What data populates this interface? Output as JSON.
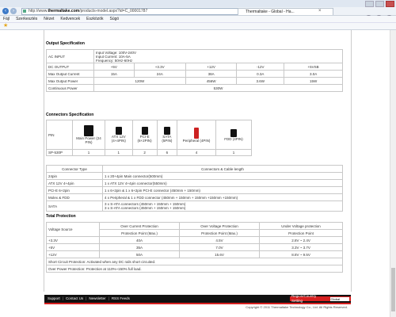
{
  "browser": {
    "url_prefix": "http://www.",
    "url_domain": "thermaltake.com",
    "url_suffix": "/products-model.aspx?id=C_00001787",
    "tab_title": "Thermaltake - Global - Ha...",
    "menu": [
      "Fájl",
      "Szerkesztés",
      "Nézet",
      "Kedvencek",
      "Eszközök",
      "Súgó"
    ]
  },
  "output_spec": {
    "title": "Output Specification",
    "ac_input_label": "AC INPUT",
    "ac_input_lines": [
      "Input Voltage: 100V-240V",
      "Input Current: 10A-5A",
      "Frequency: 50Hz-60Hz"
    ],
    "header": [
      "DC OUTPUT",
      "+5V",
      "+3.3V",
      "+12V",
      "-12V",
      "+5VSB"
    ],
    "rows": [
      [
        "Max Output Current",
        "15A",
        "24A",
        "38A",
        "0.3A",
        "3.0A"
      ],
      [
        "Max Output Power",
        "120W",
        "",
        "456W",
        "3.6W",
        "15W"
      ]
    ],
    "continuous_label": "Continuous Power",
    "continuous_value": "530W"
  },
  "connectors_spec": {
    "title": "Connectors Specification",
    "pin_label": "PIN",
    "connectors": [
      "Main Power (24 PIN)",
      "ATX 12V (4+4PIN)",
      "PCI-E (6+2PIN)",
      "SATA (5PIN)",
      "Peripheral (4PIN)",
      "FDD (4PIN)"
    ],
    "sp_label": "SP-530P",
    "counts": [
      "1",
      "1",
      "2",
      "6",
      "4",
      "1"
    ],
    "type_header": "Connector Type",
    "cable_header": "Connectors & Cable length",
    "types": [
      {
        "type": "24pin",
        "desc": "1 x 20+4pin Main connector(500mm)"
      },
      {
        "type": "ATX 12V 4+4pin",
        "desc": "1 x ATX 12V 4+4pin connector(550mm)"
      },
      {
        "type": "PCI-E 6+2pin",
        "desc": "1 x 6+2pin & 1 x 6+2pin PCI-E connector (450mm + 150mm)"
      },
      {
        "type": "Molex & FDD",
        "desc": "4 x Peripheral & 1 x FDD connector (450mm + 150mm + 150mm +150mm +150mm)"
      },
      {
        "type": "SATA",
        "desc": "3 x S-ATA connectors (450mm + 150mm + 150mm)",
        "desc2": "3 x S-ATA connectors (450mm + 150mm + 150mm)"
      }
    ]
  },
  "protection": {
    "title": "Total Protection",
    "voltage_source": "Voltage Source",
    "ocp_header": "Over Current Protection",
    "ovp_header": "Over Voltage Protection",
    "uvp_header": "Under Voltage protection",
    "ocp_sub": "Protection Point (Max.)",
    "ovp_sub": "Protection Point  (Max.)",
    "uvp_sub": "Protection Point",
    "rows": [
      [
        "+3.3V",
        "40A",
        "4.5V",
        "2.8V ~ 2.4V"
      ],
      [
        "+5V",
        "35A",
        "7.0V",
        "3.3V ~ 3.7V"
      ],
      [
        "+12V",
        "50A",
        "15.6V",
        "8.8V ~ 9.5V"
      ]
    ],
    "short_circuit": "Short Circuit Protection: Activated when any DC rails short circuited.",
    "over_power": "Over Power Protection: Protection at 110%~150% full load."
  },
  "footer": {
    "links": [
      "Support",
      "Contact Us",
      "Newsletter",
      "RSS Feeds"
    ],
    "region_label": "Region/Country Setting",
    "region_value": "Global",
    "copyright": "Copyright © 2011 Thermaltake Technology Co., Ltd. All Rights Reserved."
  },
  "colors": {
    "accent": "#d62020",
    "footer_bg": "#111111",
    "browser_blue": "#3d7ac8"
  }
}
